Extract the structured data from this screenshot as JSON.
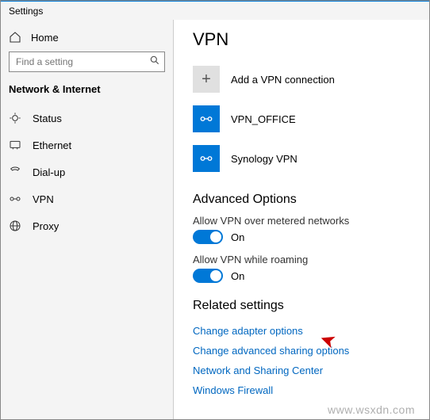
{
  "window": {
    "title": "Settings"
  },
  "sidebar": {
    "home": "Home",
    "search_placeholder": "Find a setting",
    "section": "Network & Internet",
    "items": [
      {
        "label": "Status"
      },
      {
        "label": "Ethernet"
      },
      {
        "label": "Dial-up"
      },
      {
        "label": "VPN"
      },
      {
        "label": "Proxy"
      }
    ]
  },
  "main": {
    "heading": "VPN",
    "vpn_actions": {
      "add_label": "Add a VPN connection"
    },
    "vpn_list": [
      {
        "name": "VPN_OFFICE"
      },
      {
        "name": "Synology VPN"
      }
    ],
    "advanced": {
      "heading": "Advanced Options",
      "metered_label": "Allow VPN over metered networks",
      "metered_state": "On",
      "roaming_label": "Allow VPN while roaming",
      "roaming_state": "On"
    },
    "related": {
      "heading": "Related settings",
      "links": [
        "Change adapter options",
        "Change advanced sharing options",
        "Network and Sharing Center",
        "Windows Firewall"
      ]
    }
  },
  "watermark": "www.wsxdn.com"
}
